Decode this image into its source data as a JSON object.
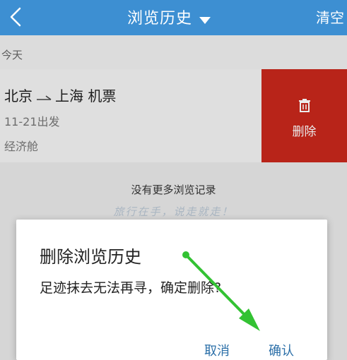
{
  "header": {
    "back_icon": "chevron-left-icon",
    "title": "浏览历史",
    "title_caret_icon": "caret-down-icon",
    "clear_label": "清空"
  },
  "section": {
    "label": "今天"
  },
  "record": {
    "from": "北京",
    "arrow_icon": "one-way-arrow-icon",
    "to": "上海",
    "type": "机票",
    "depart": "11-21出发",
    "cabin": "经济舱"
  },
  "swipe_action": {
    "icon": "trash-icon",
    "label": "删除",
    "color": "#c8281c"
  },
  "footer": {
    "no_more": "没有更多浏览记录",
    "slogan": "旅行在手，说走就走！"
  },
  "dialog": {
    "title": "删除浏览历史",
    "message": "足迹抹去无法再寻，确定删除?",
    "cancel_label": "取消",
    "confirm_label": "确认"
  },
  "colors": {
    "header": "#3d8fd2",
    "annotation_arrow": "#33c233",
    "button_text": "#2b6fa8"
  }
}
